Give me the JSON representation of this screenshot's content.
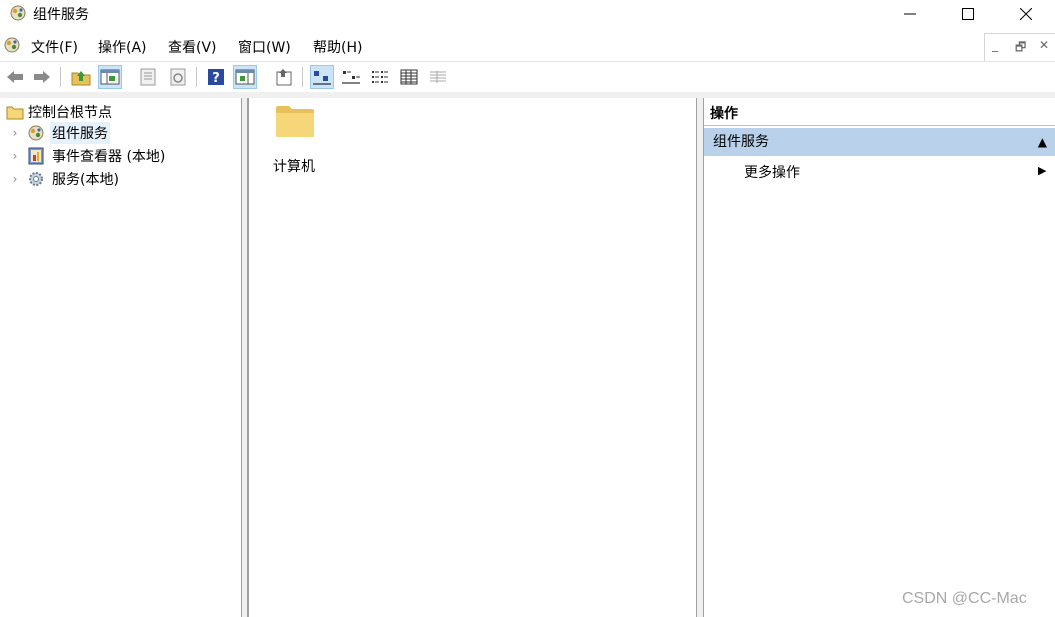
{
  "window": {
    "title": "组件服务",
    "controls": {
      "minimize": "—",
      "maximize": "☐",
      "close": "✕"
    }
  },
  "menu": {
    "items": [
      "文件(F)",
      "操作(A)",
      "查看(V)",
      "窗口(W)",
      "帮助(H)"
    ],
    "mdi_controls": {
      "minimize": "_",
      "restore": "🗗",
      "close": "✕"
    }
  },
  "toolbar": {
    "buttons": [
      "back-icon",
      "forward-icon",
      "up-folder-icon",
      "show-hide-tree-icon",
      "properties-icon",
      "refresh-icon",
      "help-icon",
      "show-action-pane-icon",
      "export-icon",
      "large-icons-view-icon",
      "small-icons-view-icon",
      "list-view-icon",
      "detail-view-icon",
      "grid-view-icon"
    ]
  },
  "tree": {
    "root": "控制台根节点",
    "nodes": [
      {
        "label": "组件服务",
        "selected": true,
        "icon": "component-services-icon"
      },
      {
        "label": "事件查看器 (本地)",
        "selected": false,
        "icon": "event-viewer-icon"
      },
      {
        "label": "服务(本地)",
        "selected": false,
        "icon": "services-gear-icon"
      }
    ]
  },
  "center": {
    "items": [
      {
        "label": "计算机",
        "icon": "folder-icon"
      }
    ]
  },
  "actions": {
    "header": "操作",
    "section": "组件服务",
    "section_arrow": "▲",
    "items": [
      {
        "label": "更多操作",
        "arrow": "▶"
      }
    ]
  },
  "watermark": "CSDN @CC-Mac",
  "colors": {
    "section_bg": "#b9d1ea",
    "selected_bg": "#e5f1fb",
    "toolbar_active": "#cce4f7",
    "folder": "#f5d77a"
  }
}
